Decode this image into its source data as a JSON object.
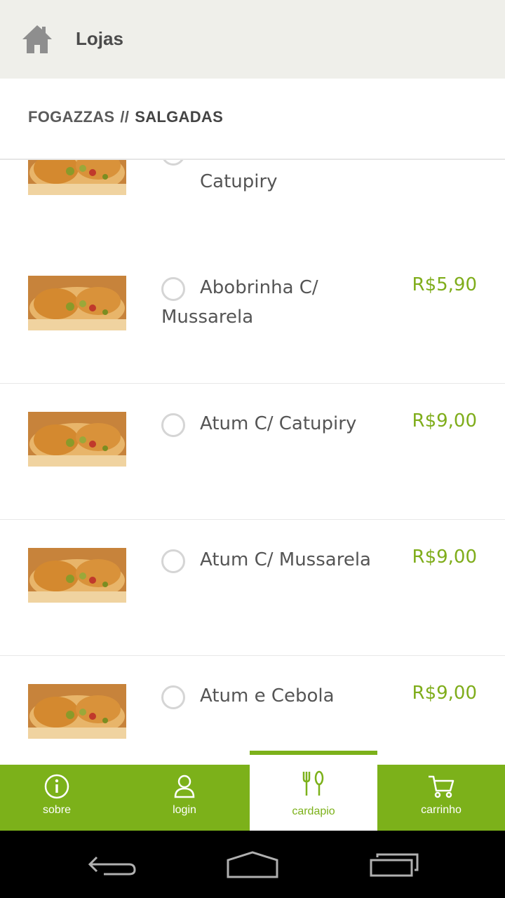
{
  "header": {
    "title": "Lojas",
    "home_icon": "home-icon"
  },
  "breadcrumb": {
    "category": "FOGAZZAS",
    "separator": "//",
    "current": "SALGADAS"
  },
  "items": [
    {
      "name": "Catupiry",
      "price": "",
      "partial": true
    },
    {
      "name": "Abobrinha C/ Mussarela",
      "price": "R$5,90"
    },
    {
      "name": "Atum C/ Catupiry",
      "price": "R$9,00"
    },
    {
      "name": "Atum C/ Mussarela",
      "price": "R$9,00"
    },
    {
      "name": "Atum e Cebola",
      "price": "R$9,00"
    }
  ],
  "bottom_nav": [
    {
      "label": "sobre",
      "icon": "info-icon"
    },
    {
      "label": "login",
      "icon": "user-icon"
    },
    {
      "label": "cardapio",
      "icon": "utensils-icon",
      "active": true
    },
    {
      "label": "carrinho",
      "icon": "cart-icon"
    }
  ],
  "colors": {
    "accent": "#7cb11a",
    "header_bg": "#efefea",
    "price": "#7fad1b"
  }
}
